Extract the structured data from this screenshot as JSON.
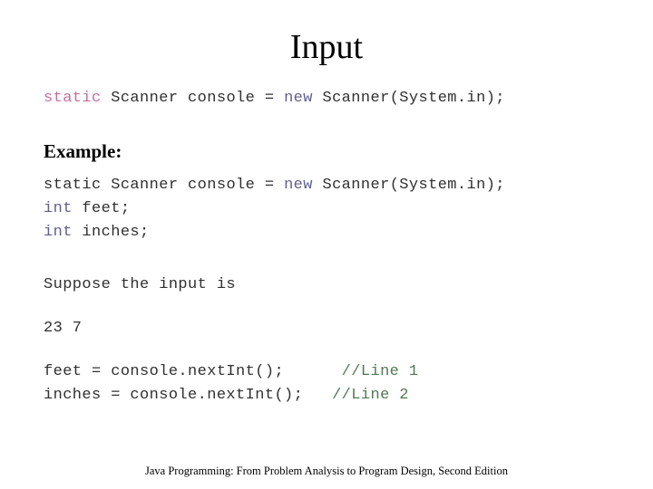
{
  "slide": {
    "title": "Input",
    "intro_code": {
      "tokens": [
        {
          "text": "static",
          "style": "pink"
        },
        {
          "text": " Scanner console = ",
          "style": "dark"
        },
        {
          "text": "new",
          "style": "blue"
        },
        {
          "text": " Scanner(System.in);",
          "style": "dark"
        }
      ],
      "plain": "static Scanner console = new Scanner(System.in);"
    },
    "example_heading": "Example:",
    "example_code": {
      "line1": {
        "tokens": [
          {
            "text": "static",
            "style": "dark"
          },
          {
            "text": " Scanner console = ",
            "style": "dark"
          },
          {
            "text": "new",
            "style": "blue"
          },
          {
            "text": " Scanner(System.in);",
            "style": "dark"
          }
        ],
        "plain": "static Scanner console = new Scanner(System.in);"
      },
      "line2": {
        "tokens": [
          {
            "text": "int",
            "style": "blue"
          },
          {
            "text": " feet;",
            "style": "dark"
          }
        ],
        "plain": "int feet;"
      },
      "line3": {
        "tokens": [
          {
            "text": "int",
            "style": "blue"
          },
          {
            "text": " inches;",
            "style": "dark"
          }
        ],
        "plain": "int inches;"
      }
    },
    "suppose_text": "Suppose the input is",
    "input_values": "23 7",
    "read_code": [
      {
        "statement": "feet = console.nextInt();",
        "comment": "//Line 1"
      },
      {
        "statement": "inches = console.nextInt();",
        "comment": "//Line 2"
      }
    ]
  },
  "footer": {
    "citation": "Java Programming: From Problem Analysis to Program Design, Second Edition"
  },
  "colors": {
    "background": "#ffffff",
    "text": "#303030",
    "keyword_pink": "#c4709c",
    "keyword_blue": "#5f5f8d",
    "comment_green": "#4f7a52",
    "title": "#000000"
  }
}
